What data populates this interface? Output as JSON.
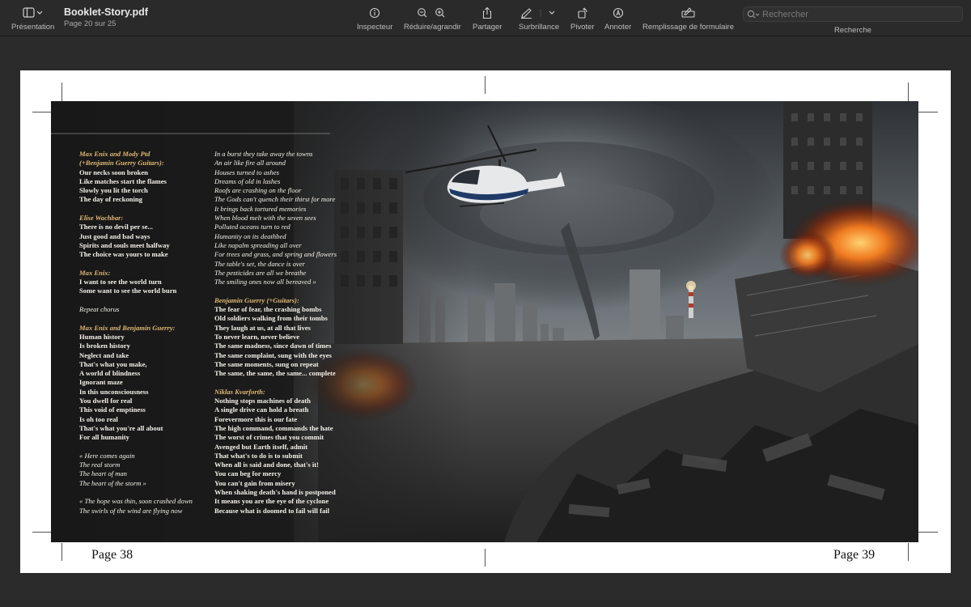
{
  "toolbar": {
    "view_label": "Présentation",
    "title": "Booklet-Story.pdf",
    "subtitle": "Page 20 sur 25",
    "buttons": [
      {
        "label": "Inspecteur",
        "icon": "info-icon"
      },
      {
        "label": "Réduire/agrandir",
        "icon": "zoom-icon"
      },
      {
        "label": "Partager",
        "icon": "share-icon"
      },
      {
        "label": "Surbrillance",
        "icon": "highlight-icon"
      },
      {
        "label": "Pivoter",
        "icon": "rotate-icon"
      },
      {
        "label": "Annoter",
        "icon": "annotate-icon"
      },
      {
        "label": "Remplissage de formulaire",
        "icon": "form-fill-icon"
      }
    ],
    "search_placeholder": "Rechercher",
    "search_label": "Recherche"
  },
  "pages": {
    "left_number": "Page 38",
    "right_number": "Page 39"
  },
  "lyrics_left": [
    {
      "t": "Max Enix and Mody Ptd",
      "s": "spk"
    },
    {
      "t": "(+Benjamin Guerry Guitars):",
      "s": "spk"
    },
    {
      "t": "Our necks soon broken",
      "s": "ln"
    },
    {
      "t": "Like matches start the flames",
      "s": "ln"
    },
    {
      "t": "Slowly you lit the torch",
      "s": "ln"
    },
    {
      "t": "The day of reckoning",
      "s": "ln"
    },
    {
      "t": "",
      "s": "gap"
    },
    {
      "t": "Elise Wachbar:",
      "s": "spk"
    },
    {
      "t": "There is no devil per se...",
      "s": "ln"
    },
    {
      "t": "Just good and bad ways",
      "s": "ln"
    },
    {
      "t": "Spirits and souls meet halfway",
      "s": "ln"
    },
    {
      "t": "The choice was yours to make",
      "s": "ln"
    },
    {
      "t": "",
      "s": "gap"
    },
    {
      "t": "Max Enix:",
      "s": "spk"
    },
    {
      "t": "I want to see the world turn",
      "s": "ln"
    },
    {
      "t": "Some want to see the world burn",
      "s": "ln"
    },
    {
      "t": "",
      "s": "gap"
    },
    {
      "t": "Repeat chorus",
      "s": "it"
    },
    {
      "t": "",
      "s": "gap"
    },
    {
      "t": "Max Enix and Benjamin Guerry:",
      "s": "spk"
    },
    {
      "t": "Human history",
      "s": "ln"
    },
    {
      "t": "Is broken history",
      "s": "ln"
    },
    {
      "t": "Neglect and take",
      "s": "ln"
    },
    {
      "t": "That's what you make,",
      "s": "ln"
    },
    {
      "t": "A world of blindness",
      "s": "ln"
    },
    {
      "t": "Ignorant maze",
      "s": "ln"
    },
    {
      "t": "In this unconsciousness",
      "s": "ln"
    },
    {
      "t": "You dwell for real",
      "s": "ln"
    },
    {
      "t": "This void of emptiness",
      "s": "ln"
    },
    {
      "t": "Is oh too real",
      "s": "ln"
    },
    {
      "t": "That's what you're all about",
      "s": "ln"
    },
    {
      "t": "For all humanity",
      "s": "ln"
    },
    {
      "t": "",
      "s": "gap"
    },
    {
      "t": "« Here comes again",
      "s": "it"
    },
    {
      "t": "The real storm",
      "s": "it"
    },
    {
      "t": "The heart of man",
      "s": "it"
    },
    {
      "t": "The heart of the storm »",
      "s": "it"
    },
    {
      "t": "",
      "s": "gap"
    },
    {
      "t": "« The hope was thin, soon crashed down",
      "s": "it"
    },
    {
      "t": "The swirls of the wind are flying now",
      "s": "it"
    }
  ],
  "lyrics_right": [
    {
      "t": "In a burst they take away the towns",
      "s": "it"
    },
    {
      "t": "An air like fire all around",
      "s": "it"
    },
    {
      "t": "Houses turned to ashes",
      "s": "it"
    },
    {
      "t": "Dreams of old in lashes",
      "s": "it"
    },
    {
      "t": "Roofs are crashing on the floor",
      "s": "it"
    },
    {
      "t": "The Gods can't quench their thirst for more",
      "s": "it"
    },
    {
      "t": "It brings back tortured memories",
      "s": "it"
    },
    {
      "t": "When blood melt with the seven sees",
      "s": "it"
    },
    {
      "t": "Polluted oceans turn to red",
      "s": "it"
    },
    {
      "t": "Humanity on its deathbed",
      "s": "it"
    },
    {
      "t": "Like napalm spreading all over",
      "s": "it"
    },
    {
      "t": "For trees and grass, and spring and flowers",
      "s": "it"
    },
    {
      "t": "The table's set, the dance is over",
      "s": "it"
    },
    {
      "t": "The pesticides are all we breathe",
      "s": "it"
    },
    {
      "t": "The smiling ones now all bereaved »",
      "s": "it"
    },
    {
      "t": "",
      "s": "gap"
    },
    {
      "t": "Benjamin Guerry (+Guitars):",
      "s": "spk"
    },
    {
      "t": "The fear of fear, the crashing bombs",
      "s": "ln"
    },
    {
      "t": "Old soldiers walking from their tombs",
      "s": "ln"
    },
    {
      "t": "They laugh at us, at all that lives",
      "s": "ln"
    },
    {
      "t": "To never learn, never believe",
      "s": "ln"
    },
    {
      "t": "The same madness, since dawn of times",
      "s": "ln"
    },
    {
      "t": "The same complaint, sung with the eyes",
      "s": "ln"
    },
    {
      "t": "The same moments, sung on repeat",
      "s": "ln"
    },
    {
      "t": "The same, the same, the same... complete",
      "s": "ln"
    },
    {
      "t": "",
      "s": "gap"
    },
    {
      "t": "Niklas Kvarforth:",
      "s": "spk"
    },
    {
      "t": "Nothing stops machines of death",
      "s": "ln"
    },
    {
      "t": "A single drive can hold a breath",
      "s": "ln"
    },
    {
      "t": "Forevermore this is our fate",
      "s": "ln"
    },
    {
      "t": "The high command, commands the hate",
      "s": "ln"
    },
    {
      "t": "The worst of crimes that you commit",
      "s": "ln"
    },
    {
      "t": "Avenged but Earth itself, admit",
      "s": "ln"
    },
    {
      "t": "That what's to do is to submit",
      "s": "ln"
    },
    {
      "t": "When all is said and done, that's it!",
      "s": "ln"
    },
    {
      "t": "You can beg for mercy",
      "s": "ln"
    },
    {
      "t": "You can't gain from misery",
      "s": "ln"
    },
    {
      "t": "When shaking death's hand is postponed",
      "s": "ln"
    },
    {
      "t": "It means you are the eye of the cyclone",
      "s": "ln"
    },
    {
      "t": "Because what is doomed to fail will fail",
      "s": "ln"
    }
  ]
}
